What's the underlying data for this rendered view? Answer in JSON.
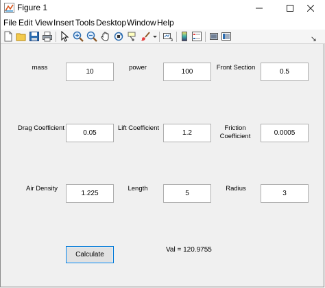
{
  "window": {
    "title": "Figure 1"
  },
  "menu": [
    "File",
    "Edit",
    "View",
    "Insert",
    "Tools",
    "Desktop",
    "Window",
    "Help"
  ],
  "toolbar_icons": [
    "new-figure-icon",
    "open-file-icon",
    "save-icon",
    "print-icon",
    "pointer-icon",
    "zoom-in-icon",
    "zoom-out-icon",
    "pan-icon",
    "rotate-3d-icon",
    "data-cursor-icon",
    "brush-icon",
    "brush-dropdown-icon",
    "link-plot-icon",
    "colorbar-icon",
    "legend-icon",
    "hide-plot-tools-icon",
    "show-plot-tools-icon"
  ],
  "colors": {
    "accent": "#0078d7",
    "background": "#f0f0f0"
  },
  "fields": [
    {
      "label": "mass",
      "value": "10"
    },
    {
      "label": "power",
      "value": "100"
    },
    {
      "label": "Front Section",
      "value": "0.5"
    },
    {
      "label": "Drag Coefficient",
      "value": "0.05"
    },
    {
      "label": "Lift Coefficient",
      "value": "1.2"
    },
    {
      "label": "Friction Coefficient",
      "value": "0.0005"
    },
    {
      "label": "Air Density",
      "value": "1.225"
    },
    {
      "label": "Length",
      "value": "5"
    },
    {
      "label": "Radius",
      "value": "3"
    }
  ],
  "calculate_label": "Calculate",
  "result_text": "Val = 120.9755"
}
